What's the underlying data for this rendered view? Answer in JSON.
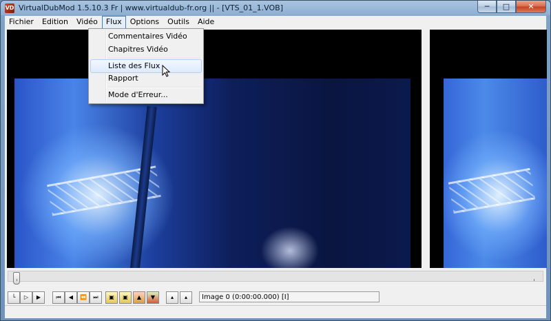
{
  "window": {
    "title": "VirtualDubMod 1.5.10.3 Fr | www.virtualdub-fr.org || - [VTS_01_1.VOB]",
    "icon_label": "VD",
    "controls": {
      "minimize": "─",
      "maximize": "□",
      "close": "✕"
    }
  },
  "menubar": {
    "items": [
      {
        "label": "Fichier"
      },
      {
        "label": "Edition"
      },
      {
        "label": "Vidéo"
      },
      {
        "label": "Flux"
      },
      {
        "label": "Options"
      },
      {
        "label": "Outils"
      },
      {
        "label": "Aide"
      }
    ],
    "active": "Flux"
  },
  "flux_menu": {
    "items": [
      {
        "label": "Commentaires Vidéo"
      },
      {
        "label": "Chapitres Vidéo"
      },
      {
        "label": "Liste des Flux"
      },
      {
        "label": "Rapport"
      },
      {
        "label": "Mode d'Erreur..."
      }
    ],
    "hovered": "Liste des Flux"
  },
  "timeline": {
    "position": 0
  },
  "toolbar": {
    "buttons": [
      {
        "icon": "stop-icon"
      },
      {
        "icon": "play-input-icon"
      },
      {
        "icon": "play-output-icon"
      },
      {
        "icon": "go-start-icon"
      },
      {
        "icon": "step-back-icon"
      },
      {
        "icon": "key-back-icon"
      },
      {
        "icon": "go-end-icon"
      },
      {
        "icon": "scene-back-icon"
      },
      {
        "icon": "scene-forward-icon"
      },
      {
        "icon": "mark-in-icon"
      },
      {
        "icon": "mark-out-icon"
      },
      {
        "icon": "prev-mark-icon"
      },
      {
        "icon": "next-mark-icon"
      }
    ],
    "frame_status": "Image 0 (0:00:00.000) [I]"
  },
  "colors": {
    "accent": "#3c7fb1",
    "menu_hover": "#ddeafd",
    "titlebar": "#8fb0d2"
  }
}
